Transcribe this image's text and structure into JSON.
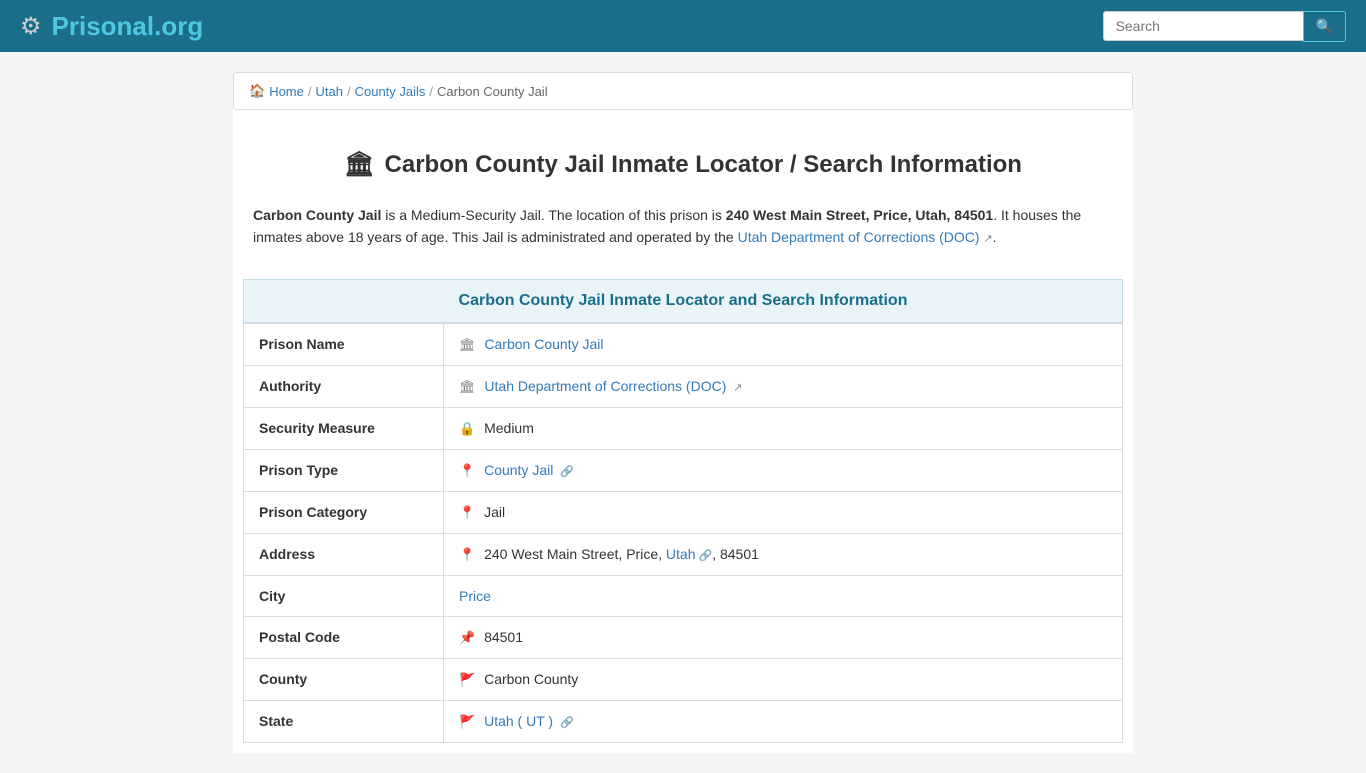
{
  "header": {
    "logo_text": "Prisonal",
    "logo_tld": ".org",
    "search_placeholder": "Search"
  },
  "breadcrumb": {
    "home_label": "Home",
    "home_icon": "🏠",
    "utah_label": "Utah",
    "county_jails_label": "County Jails",
    "current_label": "Carbon County Jail"
  },
  "page": {
    "title": "Carbon County Jail Inmate Locator / Search Information",
    "jail_icon": "🏛"
  },
  "description": {
    "jail_name_bold": "Carbon County Jail",
    "text1": " is a Medium-Security Jail. The location of this prison is ",
    "address_bold": "240 West Main Street, Price, Utah, 84501",
    "text2": ". It houses the inmates above 18 years of age. This Jail is administrated and operated by the ",
    "doc_link_label": "Utah Department of Corrections (DOC)",
    "text3": "."
  },
  "section_header": "Carbon County Jail Inmate Locator and Search Information",
  "table": {
    "rows": [
      {
        "label": "Prison Name",
        "icon": "🏛",
        "value": "Carbon County Jail",
        "is_link": true,
        "link_text": "Carbon County Jail"
      },
      {
        "label": "Authority",
        "icon": "🏛",
        "value": "Utah Department of Corrections (DOC)",
        "is_link": true,
        "link_text": "Utah Department of Corrections (DOC)",
        "has_ext": true
      },
      {
        "label": "Security Measure",
        "icon": "🔒",
        "value": "Medium",
        "is_link": false
      },
      {
        "label": "Prison Type",
        "icon": "📍",
        "value": "County Jail",
        "is_link": true,
        "link_text": "County Jail",
        "has_chain": true
      },
      {
        "label": "Prison Category",
        "icon": "📍",
        "value": "Jail",
        "is_link": false
      },
      {
        "label": "Address",
        "icon": "📍",
        "value_parts": [
          "240 West Main Street, Price, ",
          "Utah",
          ", 84501"
        ],
        "state_link": "Utah",
        "is_address": true
      },
      {
        "label": "City",
        "icon": "",
        "value": "Price",
        "is_link": true,
        "link_text": "Price"
      },
      {
        "label": "Postal Code",
        "icon": "📌",
        "value": "84501",
        "is_link": false
      },
      {
        "label": "County",
        "icon": "🚩",
        "value": "Carbon County",
        "is_link": false
      },
      {
        "label": "State",
        "icon": "🚩",
        "value": "Utah ( UT )",
        "is_link": true,
        "link_text": "Utah ( UT )",
        "has_chain": true
      }
    ]
  }
}
